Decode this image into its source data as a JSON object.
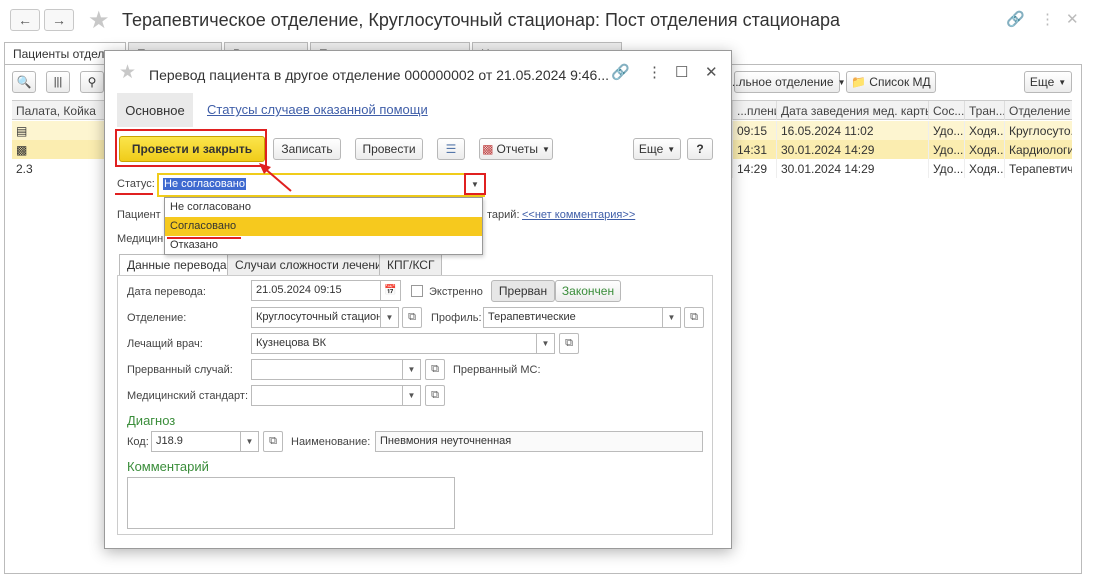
{
  "window": {
    "title": "Терапевтическое отделение, Круглосуточный стационар: Пост отделения стационара",
    "back_icon": "arrow-left-icon",
    "forward_icon": "arrow-right-icon",
    "tabs": [
      "Пациенты отделе...",
      "П...",
      "Р...",
      "П...",
      "Н..."
    ]
  },
  "toolbar": {
    "dept_button": "...льное отделение",
    "list_md_button": "Список МД",
    "more_button": "Еще"
  },
  "grid": {
    "col_ward": "Палата, Койка",
    "col_admission_time": "...пления",
    "col_record_date": "Дата заведения мед. карты",
    "col_state": "Сос...",
    "col_transport": "Тран...",
    "col_department": "Отделение",
    "rows": [
      {
        "ward": "",
        "admission": "09:15",
        "record_date": "16.05.2024 11:02",
        "state": "Удо...",
        "transport": "Ходя...",
        "department": "Круглосуто..."
      },
      {
        "ward": "",
        "admission": "14:31",
        "record_date": "30.01.2024 14:29",
        "state": "Удо...",
        "transport": "Ходя...",
        "department": "Кардиологи..."
      },
      {
        "ward": "2.3",
        "admission": "14:29",
        "record_date": "30.01.2024 14:29",
        "state": "Удо...",
        "transport": "Ходя...",
        "department": "Терапевтич..."
      }
    ]
  },
  "dialog": {
    "title": "Перевод пациента в другое отделение 000000002 от 21.05.2024 9:46...",
    "section_main": "Основное",
    "section_statuses": "Статусы случаев оказанной помощи",
    "btn_post_close": "Провести и закрыть",
    "btn_save": "Записать",
    "btn_post": "Провести",
    "btn_reports": "Отчеты",
    "btn_more": "Еще",
    "btn_help": "?",
    "status_label": "Статус:",
    "status_value": "Не согласовано",
    "status_options": [
      "Не согласовано",
      "Согласовано",
      "Отказано"
    ],
    "patient_label": "Пациент",
    "medic_label": "Медицин",
    "comment_label_tail": "тарий:",
    "no_comment_link": "<<нет комментария>>",
    "tabs": [
      "Данные перевода",
      "Случаи сложности лечения",
      "КПГ/КСГ"
    ],
    "transfer_date_label": "Дата перевода:",
    "transfer_date": "21.05.2024 09:15",
    "emergency_label": "Экстренно",
    "interrupted_button": "Прерван",
    "finished_button": "Закончен",
    "department_label": "Отделение:",
    "department_value": "Круглосуточный стацион",
    "profile_label": "Профиль:",
    "profile_value": "Терапевтические",
    "doctor_label": "Лечащий врач:",
    "doctor_value": "Кузнецова ВК",
    "interrupted_case_label": "Прерванный случай:",
    "interrupted_case_value": "",
    "interrupted_ms_label": "Прерванный МС:",
    "med_standard_label": "Медицинский стандарт:",
    "med_standard_value": "",
    "diagnosis_header": "Диагноз",
    "code_label": "Код:",
    "code_value": "J18.9",
    "name_label": "Наименование:",
    "name_value": "Пневмония неуточненная",
    "comment_header": "Комментарий",
    "comment_value": ""
  },
  "colors": {
    "accent_yellow": "#f6c91e",
    "link_blue": "#3f5ea8",
    "green_text": "#3a8d3a",
    "annotation_red": "#e02020",
    "selected_row": "#fbedb0"
  }
}
